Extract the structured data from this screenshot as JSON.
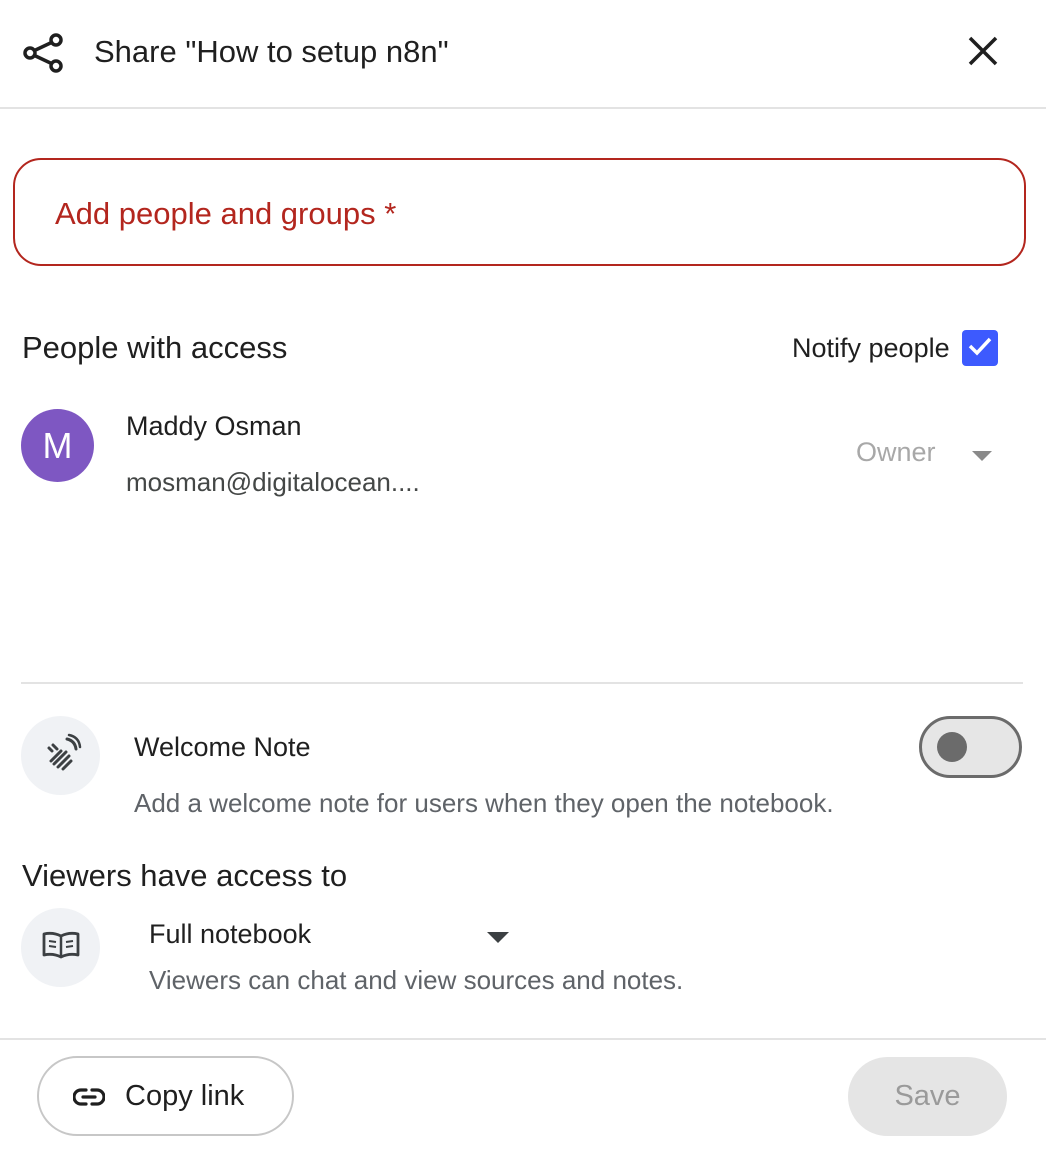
{
  "header": {
    "title": "Share \"How to setup n8n\"",
    "share_icon": "share-icon",
    "close_icon": "close-icon"
  },
  "add_input": {
    "placeholder": "Add people and groups *"
  },
  "people_section": {
    "heading": "People with access",
    "notify_label": "Notify people",
    "notify_checked": true,
    "people": [
      {
        "avatar_initial": "M",
        "name": "Maddy Osman",
        "email": "mosman@digitalocean....",
        "role": "Owner"
      }
    ]
  },
  "welcome_note": {
    "icon": "waving-hand-icon",
    "title": "Welcome Note",
    "description": "Add a welcome note for users when they open the notebook.",
    "enabled": false
  },
  "viewers_access": {
    "heading": "Viewers have access to",
    "icon": "book-icon",
    "selected": "Full notebook",
    "description": "Viewers can chat and view sources and notes."
  },
  "footer": {
    "copy_link_label": "Copy link",
    "copy_link_icon": "link-icon",
    "save_label": "Save"
  },
  "colors": {
    "error": "#b3261e",
    "checkbox": "#3d5afe",
    "avatar": "#7e57c2"
  }
}
